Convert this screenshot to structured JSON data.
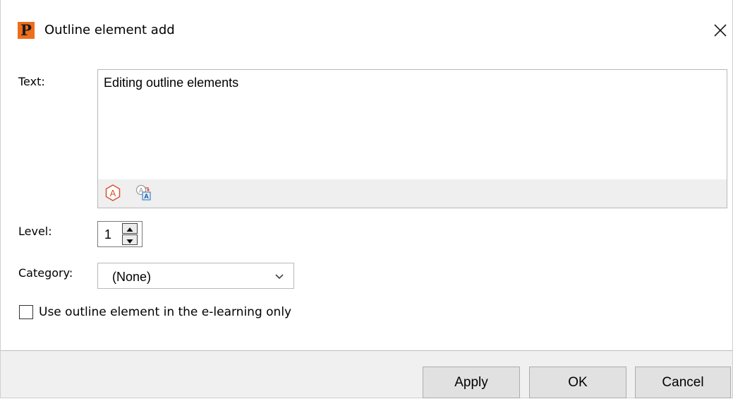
{
  "window": {
    "title": "Outline element add",
    "app_logo_glyph": "P",
    "accent_color": "#ee6e1c"
  },
  "form": {
    "text_label": "Text:",
    "text_value": "Editing outline elements",
    "level_label": "Level:",
    "level_value": "1",
    "category_label": "Category:",
    "category_value": "(None)",
    "elearning_only_label": "Use outline element in the e-learning only",
    "elearning_only_checked": false
  },
  "toolbar": {
    "icons": [
      "font-style-icon",
      "translate-icon"
    ]
  },
  "buttons": {
    "apply": "Apply",
    "ok": "OK",
    "cancel": "Cancel"
  }
}
